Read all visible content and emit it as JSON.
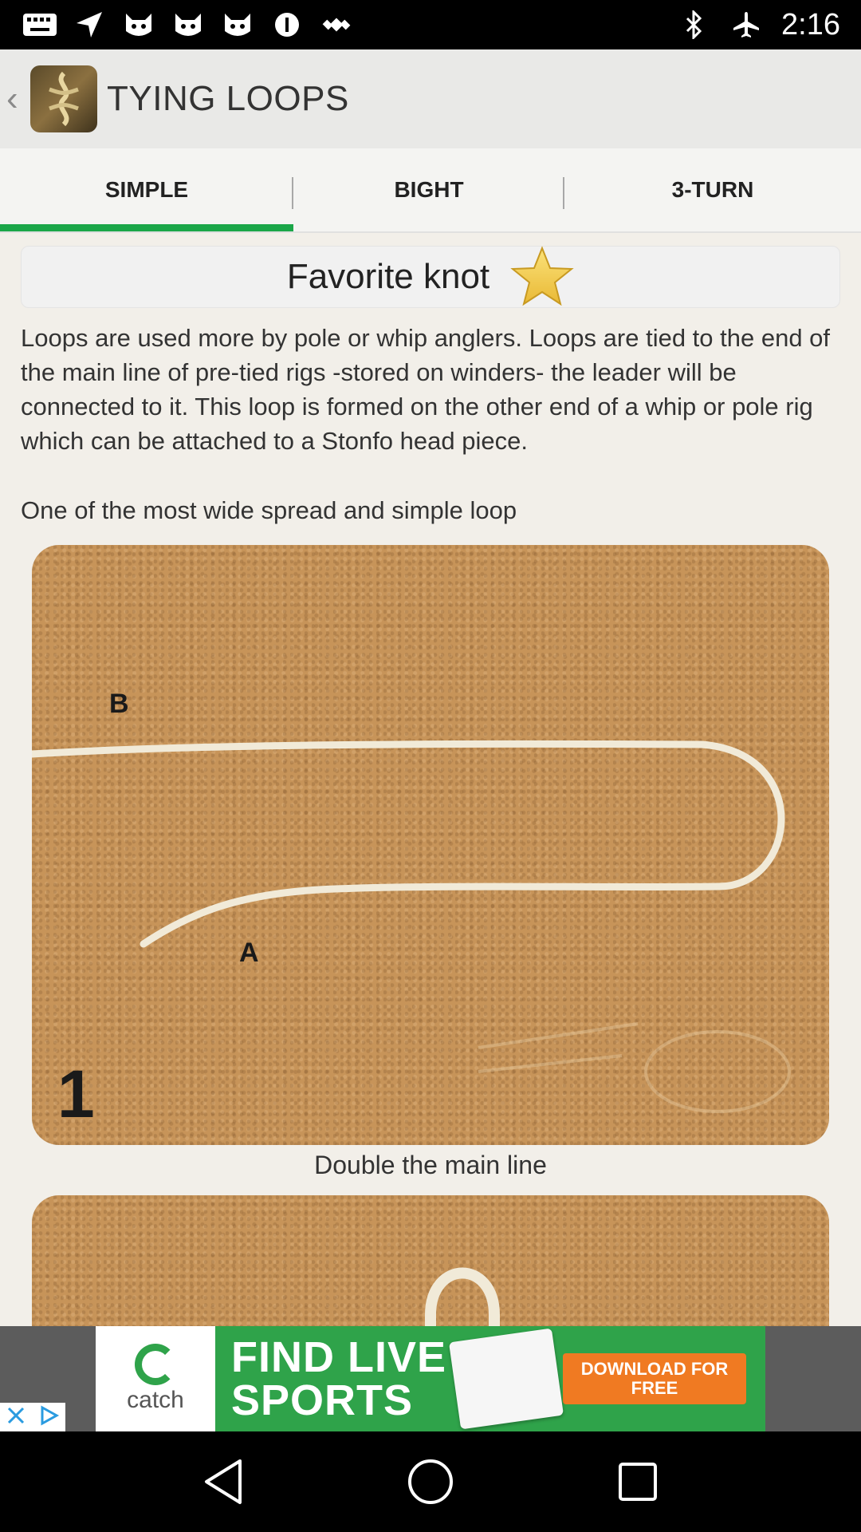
{
  "status_bar": {
    "time": "2:16"
  },
  "app_bar": {
    "title": "TYING LOOPS"
  },
  "tabs": [
    {
      "label": "SIMPLE",
      "selected": true
    },
    {
      "label": "BIGHT",
      "selected": false
    },
    {
      "label": "3-TURN",
      "selected": false
    }
  ],
  "content": {
    "favorite_label": "Favorite knot",
    "description": "Loops are used more by pole or whip anglers. Loops are tied to the end of the main line of pre-tied rigs -stored on winders- the leader will be connected to it. This loop is formed on the other end of a whip or pole rig which can be attached to a Stonfo head piece.",
    "subdescription": "One of the most wide spread and simple loop",
    "step1": {
      "label_b": "B",
      "label_a": "A",
      "number": "1",
      "caption": "Double the main line"
    }
  },
  "ad": {
    "brand": "catch",
    "headline_line1": "FIND LIVE",
    "headline_line2": "SPORTS",
    "cta": "DOWNLOAD FOR FREE"
  },
  "colors": {
    "tab_indicator": "#1aa648",
    "ad_green": "#2fa34a",
    "ad_orange": "#f07a22"
  }
}
